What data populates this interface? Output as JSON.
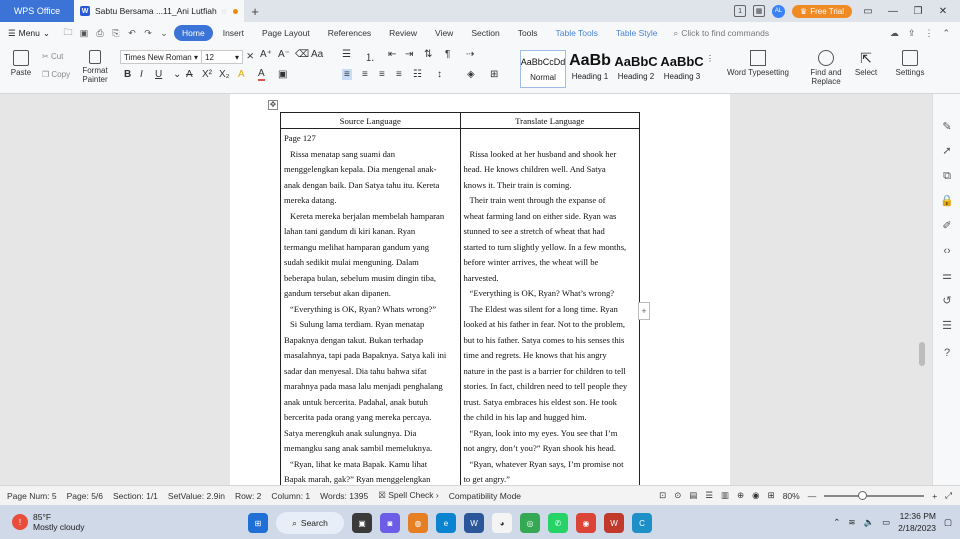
{
  "titlebar": {
    "app_tab": "WPS Office",
    "doc_tab": "Sabtu Bersama ...11_Ani Lutfiah",
    "avatar_initials": "AL",
    "free_trial": "Free Trial"
  },
  "menubar": {
    "menu_label": "Menu",
    "tabs": [
      "Home",
      "Insert",
      "Page Layout",
      "References",
      "Review",
      "View",
      "Section",
      "Tools"
    ],
    "context_tabs": [
      "Table Tools",
      "Table Style"
    ],
    "find_placeholder": "Click to find commands"
  },
  "ribbon": {
    "paste": "Paste",
    "cut": "Cut",
    "copy": "Copy",
    "format_painter": "Format Painter",
    "font_name": "Times New Roman",
    "font_size": "12",
    "styles": [
      {
        "sample": "AaBbCcDd",
        "label": "Normal"
      },
      {
        "sample": "AaBb",
        "label": "Heading 1"
      },
      {
        "sample": "AaBbC",
        "label": "Heading 2"
      },
      {
        "sample": "AaBbC",
        "label": "Heading 3"
      }
    ],
    "word_typesetting": "Word Typesetting",
    "find_replace": "Find and Replace",
    "select": "Select",
    "settings": "Settings"
  },
  "document": {
    "table_headers": [
      "Source Language",
      "Translate Language"
    ],
    "page_label": "Page 127",
    "source_lines": [
      "Rissa menatap sang suami dan",
      "menggelengkan kepala. Dia mengenal anak-",
      "anak dengan baik. Dan Satya tahu itu. Kereta",
      "mereka datang.",
      "Kereta mereka berjalan membelah hamparan",
      "lahan tani gandum di kiri kanan. Ryan",
      "termangu melihat hamparan gandum yang",
      "sudah sedikit mulai menguning. Dalam",
      "beberapa bulan, sebelum musim dingin tiba,",
      "gandum tersebut akan dipanen.",
      "“Everything is OK, Ryan? Whats wrong?”",
      "Si Sulung lama terdiam. Ryan menatap",
      "Bapaknya dengan takut. Bukan terhadap",
      "masalahnya, tapi pada Bapaknya. Satya kali ini",
      "sadar dan menyesal. Dia tahu bahwa sifat",
      "marahnya pada masa lalu menjadi penghalang",
      "anak untuk bercerita. Padahal, anak butuh",
      "bercerita pada orang yang mereka percaya.",
      "Satya merengkuh anak sulungnya. Dia",
      "memangku sang anak sambil memeluknya.",
      "“Ryan, lihat ke mata Bapak. Kamu lihat",
      "Bapak marah, gak?” Ryan menggelengkan"
    ],
    "target_lines": [
      "Rissa looked at her husband and shook her",
      "head. He knows children well. And Satya",
      "knows it. Their train is coming.",
      "Their train went through the expanse of",
      "wheat farming land on either side. Ryan was",
      "stunned to see a stretch of wheat that had",
      "started to turn slightly yellow. In a few months,",
      "before winter arrives, the wheat will be",
      "harvested.",
      "“Everything is OK, Ryan? What’s wrong?",
      "The Eldest was silent for a long time. Ryan",
      "looked at his father in fear. Not to the problem,",
      "but to his father. Satya comes to his senses this",
      "time and regrets. He knows that his angry",
      "nature in the past is a barrier for children to tell",
      "stories. In fact, children need to tell people they",
      "trust. Satya embraces his eldest son. He took",
      "the child in his lap and hugged him.",
      "“Ryan, look into my eyes. You see that I’m",
      "not angry, don’t you?” Ryan shook his head.",
      "“Ryan, whatever Ryan says, I’m promise not",
      "to get angry.”"
    ]
  },
  "statusbar": {
    "page_num": "Page Num: 5",
    "page": "Page: 5/6",
    "section": "Section: 1/1",
    "setvalue": "SetValue: 2.9in",
    "row": "Row: 2",
    "column": "Column: 1",
    "words": "Words: 1395",
    "spell_check": "Spell Check",
    "compat": "Compatibility Mode",
    "zoom": "80%",
    "zoom_fraction": 0.38
  },
  "taskbar": {
    "temperature": "85°F",
    "weather": "Mostly cloudy",
    "search": "Search",
    "time": "12:36 PM",
    "date": "2/18/2023"
  }
}
